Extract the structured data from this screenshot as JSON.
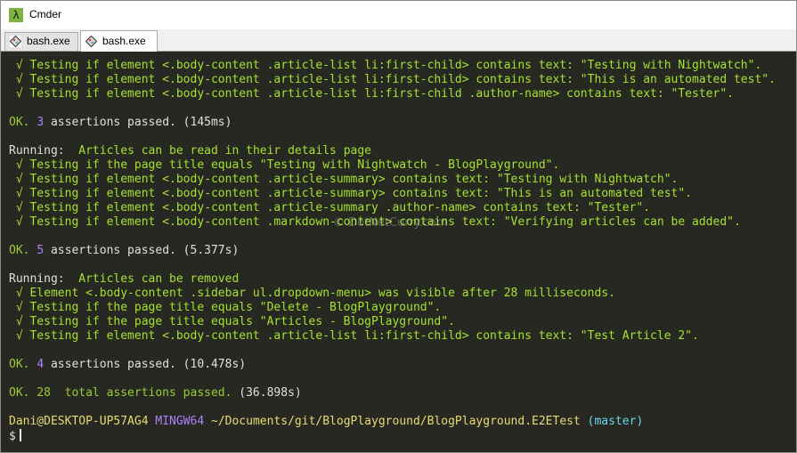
{
  "window": {
    "title": "Cmder",
    "app_icon_glyph": "λ"
  },
  "tabs": [
    {
      "label": "bash.exe",
      "active": false
    },
    {
      "label": "bash.exe",
      "active": true
    }
  ],
  "watermark": "© DotNetCurry.com",
  "colors": {
    "console_bg": "#272822",
    "green": "#a6e22e",
    "accent_app_icon": "#7cb342"
  },
  "console": {
    "lines": {
      "l1": " √ Testing if element <.body-content .article-list li:first-child> contains text: \"Testing with Nightwatch\".",
      "l2": " √ Testing if element <.body-content .article-list li:first-child> contains text: \"This is an automated test\".",
      "l3": " √ Testing if element <.body-content .article-list li:first-child .author-name> contains text: \"Tester\".",
      "l5_ok": "OK. ",
      "l5_count": "3",
      "l5_rest": " assertions passed. (145ms)",
      "l7_prefix": "Running:  ",
      "l7_title": "Articles can be read in their details page",
      "l8": " √ Testing if the page title equals \"Testing with Nightwatch - BlogPlayground\".",
      "l9": " √ Testing if element <.body-content .article-summary> contains text: \"Testing with Nightwatch\".",
      "l10": " √ Testing if element <.body-content .article-summary> contains text: \"This is an automated test\".",
      "l11": " √ Testing if element <.body-content .article-summary .author-name> contains text: \"Tester\".",
      "l12": " √ Testing if element <.body-content .markdown-content> contains text: \"Verifying articles can be added\".",
      "l14_ok": "OK. ",
      "l14_count": "5",
      "l14_rest": " assertions passed. (5.377s)",
      "l16_prefix": "Running:  ",
      "l16_title": "Articles can be removed",
      "l17": " √ Element <.body-content .sidebar ul.dropdown-menu> was visible after 28 milliseconds.",
      "l18": " √ Testing if the page title equals \"Delete - BlogPlayground\".",
      "l19": " √ Testing if the page title equals \"Articles - BlogPlayground\".",
      "l20": " √ Testing if element <.body-content .article-list li:first-child> contains text: \"Test Article 2\".",
      "l22_ok": "OK. ",
      "l22_count": "4",
      "l22_rest": " assertions passed. (10.478s)",
      "l24_ok": "OK. 28  total assertions passed. ",
      "l24_time": "(36.898s)",
      "prompt_user": "Dani@DESKTOP-UP57AG4",
      "prompt_env": "MINGW64",
      "prompt_path": "~/Documents/git/BlogPlayground/BlogPlayground.E2ETest",
      "prompt_branch": "(master)",
      "prompt_symbol": "$"
    }
  }
}
